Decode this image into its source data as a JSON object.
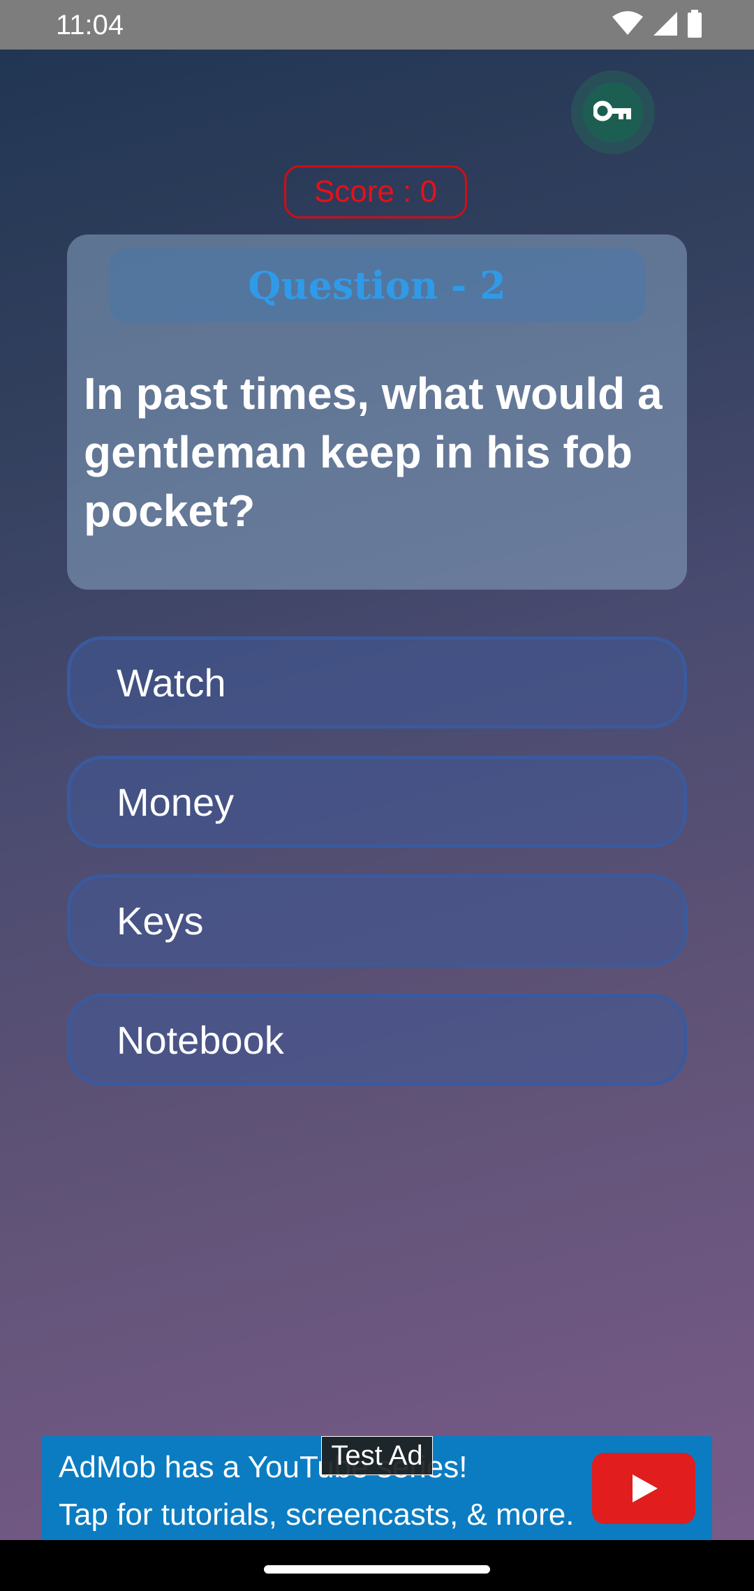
{
  "status_bar": {
    "time": "11:04",
    "icons": [
      "wifi-icon",
      "signal-icon",
      "battery-icon"
    ]
  },
  "header": {
    "key_icon": "key-icon",
    "score_label": "Score : 0"
  },
  "question": {
    "title": "Question - 2",
    "text": "In past times, what would a gentleman keep in his fob pocket?"
  },
  "answers": [
    {
      "label": "Watch"
    },
    {
      "label": "Money"
    },
    {
      "label": "Keys"
    },
    {
      "label": "Notebook"
    }
  ],
  "ad": {
    "label": "Test Ad",
    "line1": "AdMob has a YouTube series!",
    "line2": "Tap for tutorials, screencasts, & more.",
    "icon": "youtube-icon"
  },
  "colors": {
    "score_red": "#e8101a",
    "question_title_blue": "#2f9be8",
    "answer_border": "#3a5a9e",
    "key_button_green": "#1c5f52",
    "ad_blue": "#0b7cc2",
    "youtube_red": "#e11d1d"
  }
}
